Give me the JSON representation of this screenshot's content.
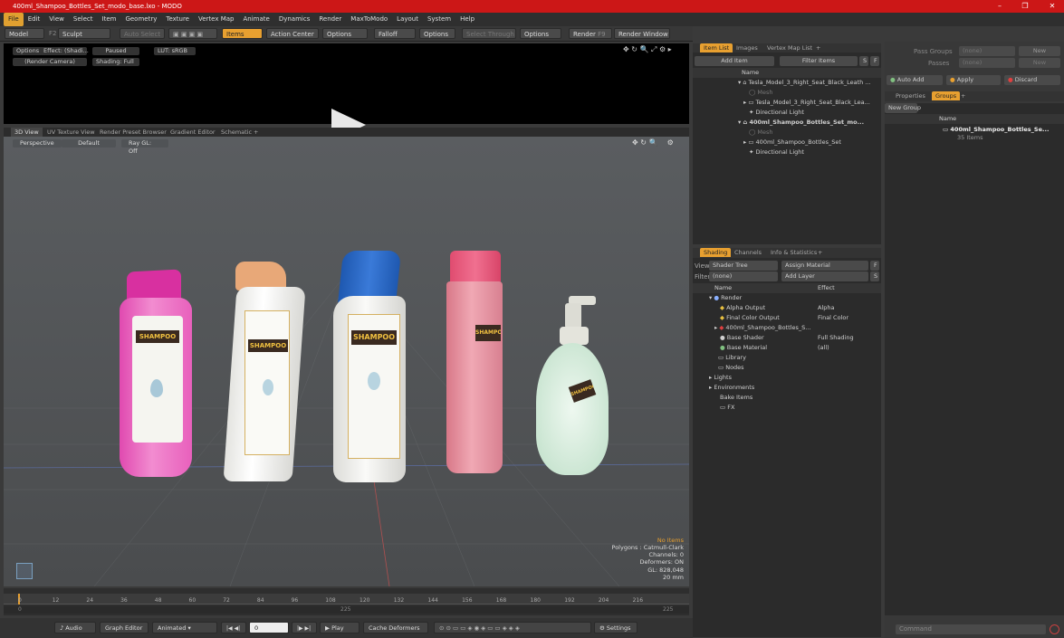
{
  "window": {
    "title": "400ml_Shampoo_Bottles_Set_modo_base.lxo - MODO",
    "min": "–",
    "max": "❐",
    "close": "✕"
  },
  "menu": [
    "File",
    "Edit",
    "View",
    "Select",
    "Item",
    "Geometry",
    "Texture",
    "Vertex Map",
    "Animate",
    "Dynamics",
    "Render",
    "MaxToModo",
    "Layout",
    "System",
    "Help"
  ],
  "toolbar": {
    "model": "Model",
    "f2": "F2",
    "sculpt": "Sculpt",
    "auto_select": "Auto Select",
    "items": "Items",
    "action_center": "Action Center",
    "options1": "Options",
    "falloff": "Falloff",
    "options2": "Options",
    "select_through": "Select Through",
    "options3": "Options",
    "render": "Render",
    "f9": "F9",
    "render_window": "Render Window"
  },
  "preview": {
    "options": "Options",
    "effect": "Effect: (Shadi...",
    "paused": "Paused",
    "lut": "LUT: sRGB",
    "camera": "(Render Camera)",
    "shading": "Shading: Full"
  },
  "viewport_tabs": [
    "3D View",
    "UV Texture View",
    "Render Preset Browser",
    "Gradient Editor",
    "Schematic",
    "+"
  ],
  "viewport": {
    "perspective": "Perspective",
    "default": "Default",
    "raygl": "Ray GL: Off",
    "stats": [
      "No Items",
      "Polygons : Catmull-Clark",
      "Channels: 0",
      "Deformers: ON",
      "GL: 828,048",
      "20 mm"
    ]
  },
  "timeline": {
    "ticks": [
      "0",
      "12",
      "24",
      "36",
      "48",
      "60",
      "72",
      "84",
      "96",
      "108",
      "120",
      "132",
      "144",
      "156",
      "168",
      "180",
      "192",
      "204",
      "216"
    ],
    "start": "0",
    "mid": "225",
    "end": "225"
  },
  "bottombar": {
    "audio": "Audio",
    "graph_editor": "Graph Editor",
    "animated": "Animated",
    "frame": "0",
    "play": "Play",
    "cache": "Cache Deformers",
    "settings": "Settings"
  },
  "item_list": {
    "tabs": [
      "Item List",
      "Images",
      "Vertex Map List",
      "+"
    ],
    "add_item": "Add Item",
    "filter": "Filter Items",
    "s": "S",
    "f": "F",
    "name_header": "Name",
    "rows": [
      "Tesla_Model_3_Right_Seat_Black_Leath ...",
      "Mesh",
      "Tesla_Model_3_Right_Seat_Black_Lea...",
      "Directional Light",
      "400ml_Shampoo_Bottles_Set_mo...",
      "Mesh",
      "400ml_Shampoo_Bottles_Set",
      "Directional Light"
    ]
  },
  "shading": {
    "tabs": [
      "Shading",
      "Channels",
      "Info & Statistics",
      "+"
    ],
    "view_label": "View",
    "view_value": "Shader Tree",
    "assign": "Assign Material",
    "f": "F",
    "filter_label": "Filter",
    "filter_value": "(none)",
    "add_layer": "Add Layer",
    "s": "S",
    "name_header": "Name",
    "effect_header": "Effect",
    "rows": [
      {
        "name": "Render",
        "effect": ""
      },
      {
        "name": "Alpha Output",
        "effect": "Alpha"
      },
      {
        "name": "Final Color Output",
        "effect": "Final Color"
      },
      {
        "name": "400ml_Shampoo_Bottles_S...",
        "effect": ""
      },
      {
        "name": "Base Shader",
        "effect": "Full Shading"
      },
      {
        "name": "Base Material",
        "effect": "(all)"
      },
      {
        "name": "Library",
        "effect": ""
      },
      {
        "name": "Nodes",
        "effect": ""
      },
      {
        "name": "Lights",
        "effect": ""
      },
      {
        "name": "Environments",
        "effect": ""
      },
      {
        "name": "Bake Items",
        "effect": ""
      },
      {
        "name": "FX",
        "effect": ""
      }
    ]
  },
  "right": {
    "pass_groups": "Pass Groups",
    "passes": "Passes",
    "none1": "(none)",
    "none2": "(none)",
    "new1": "New",
    "new2": "New",
    "auto_add": "Auto Add",
    "apply": "Apply",
    "discard": "Discard",
    "tabs": [
      "Properties",
      "Groups",
      "+"
    ],
    "new_group": "New Group",
    "name_header": "Name",
    "group_name": "400ml_Shampoo_Bottles_Se...",
    "group_count": "35 Items",
    "command": "Command"
  },
  "bottles": [
    {
      "label": "SHAMPOO",
      "sub": "FOR NORMAL HAIR",
      "cap": "#e040a8",
      "body": "#e868c0"
    },
    {
      "label": "SHAMPOO",
      "sub": "FOR NORMAL HAIR",
      "cap": "#e8a070",
      "body": "#f0f0ee"
    },
    {
      "label": "SHAMPOO",
      "sub": "FOR NORMAL HAIR",
      "cap": "#2860b8",
      "body": "#f0f0ee"
    },
    {
      "label": "SHAMPOO",
      "sub": "FOR NORMAL HAIR",
      "cap": "#e85878",
      "body": "#e89aa8"
    },
    {
      "label": "SHAMPOO",
      "sub": "FOR NORMAL HAIR",
      "cap": "#e8e8e0",
      "body": "#d8eee0"
    }
  ]
}
